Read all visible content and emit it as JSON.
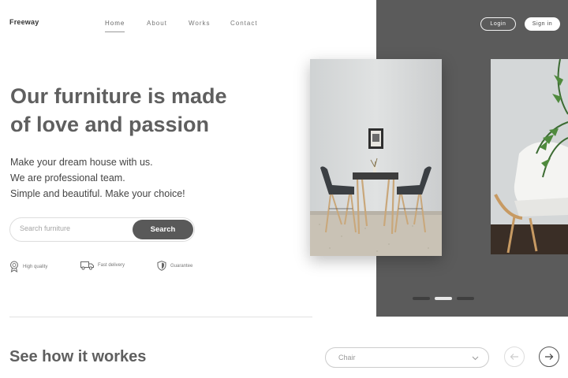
{
  "header": {
    "logo": "Freeway",
    "nav": [
      {
        "label": "Home",
        "active": true
      },
      {
        "label": "About"
      },
      {
        "label": "Works"
      },
      {
        "label": "Contact"
      }
    ],
    "login_label": "Login",
    "signin_label": "Sign in"
  },
  "hero": {
    "title_line1": "Our furniture is made",
    "title_line2": "of love and passion",
    "subtitle_lines": [
      "Make your dream house with us.",
      "We are professional team.",
      "Simple and beautiful. Make your choice!"
    ],
    "search": {
      "placeholder": "Search furniture",
      "button_label": "Search"
    },
    "features": [
      {
        "icon": "medal-icon",
        "label": "High quality"
      },
      {
        "icon": "truck-icon",
        "label": "Fast delivery"
      },
      {
        "icon": "shield-icon",
        "label": "Guarantee"
      }
    ]
  },
  "slider": {
    "active_dot": 2,
    "dot_count": 3
  },
  "how_it_works": {
    "title": "See how it workes",
    "category_value": "Chair"
  },
  "colors": {
    "panel": "#5b5b5b",
    "accent": "#595959",
    "title_text": "#5f5f5f"
  }
}
